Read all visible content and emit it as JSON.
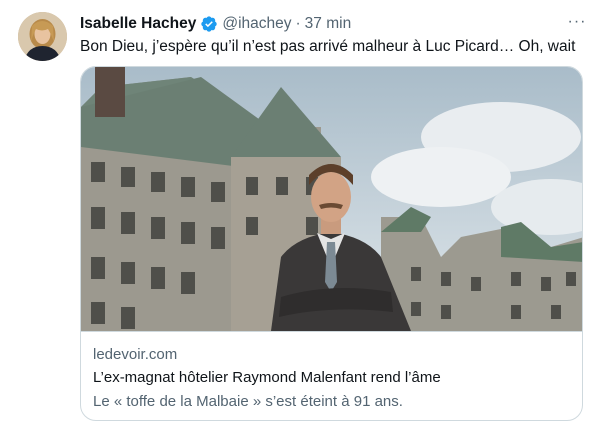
{
  "tweet": {
    "author_name": "Isabelle Hachey",
    "handle": "@ihachey",
    "separator": "·",
    "timestamp": "37 min",
    "text": "Bon Dieu, j’espère qu’il n’est pas arrivé malheur à Luc Picard… Oh, wait",
    "more_label": "···"
  },
  "card": {
    "domain": "ledevoir.com",
    "title": "L’ex-magnat hôtelier Raymond Malenfant rend l’âme",
    "description": "Le « toffe de la Malbaie » s’est éteint à 91 ans."
  },
  "colors": {
    "verified": "#1d9bf0",
    "secondary_text": "#536471",
    "border": "#cfd9de",
    "primary_text": "#0f1419"
  },
  "icons": {
    "verified": "verified-badge-icon",
    "more": "more-dots-icon"
  }
}
